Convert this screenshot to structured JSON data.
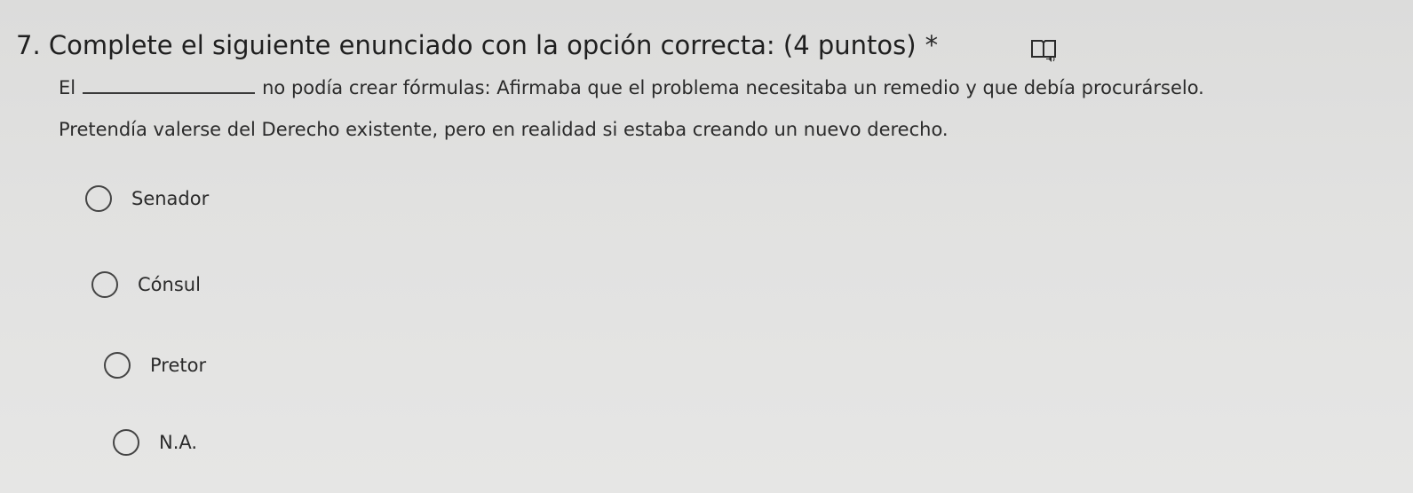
{
  "question": {
    "title": "7. Complete el siguiente enunciado con la opción correcta: (4 puntos)",
    "required_marker": "*",
    "reader_icon": "immersive-reader-icon"
  },
  "prompt": {
    "line1_start": "El",
    "line1_end": "no podía crear fórmulas: Afirmaba que el problema necesitaba un remedio y que debía procurárselo.",
    "line2": "Pretendía valerse del Derecho existente, pero en realidad si estaba creando un nuevo derecho."
  },
  "options": [
    {
      "label": "Senador",
      "selected": false
    },
    {
      "label": "Cónsul",
      "selected": false
    },
    {
      "label": "Pretor",
      "selected": false
    },
    {
      "label": "N.A.",
      "selected": false
    }
  ],
  "colors": {
    "background": "#e1e1e0",
    "text": "#222222",
    "radio_border": "#444444"
  }
}
